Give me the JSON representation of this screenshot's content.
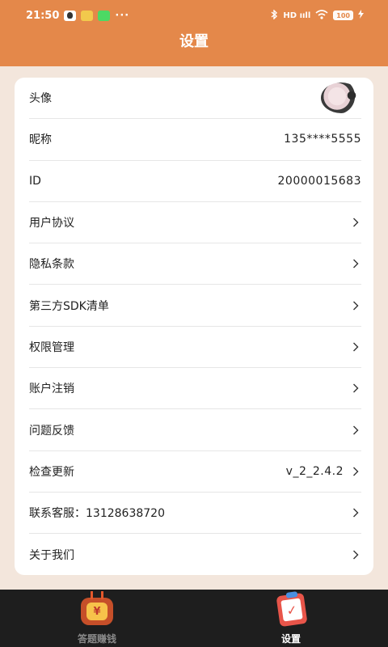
{
  "status_bar": {
    "time": "21:50",
    "dots": "···",
    "signal_text": "HD ııll",
    "battery": "100"
  },
  "header": {
    "title": "设置"
  },
  "settings": [
    {
      "label": "头像",
      "type": "avatar"
    },
    {
      "label": "昵称",
      "value": "135****5555"
    },
    {
      "label": "ID",
      "value": "20000015683"
    },
    {
      "label": "用户协议",
      "chevron": true
    },
    {
      "label": "隐私条款",
      "chevron": true
    },
    {
      "label": "第三方SDK清单",
      "chevron": true
    },
    {
      "label": "权限管理",
      "chevron": true
    },
    {
      "label": "账户注销",
      "chevron": true
    },
    {
      "label": "问题反馈",
      "chevron": true
    },
    {
      "label": "检查更新",
      "value": "v_2_2.4.2",
      "chevron": true
    },
    {
      "label": "联系客服：13128638720",
      "chevron": true
    },
    {
      "label": "关于我们",
      "chevron": true
    }
  ],
  "tabbar": {
    "tabs": [
      {
        "label": "答题赚钱",
        "icon": "tv-coin-icon",
        "active": false,
        "glyph": "¥"
      },
      {
        "label": "设置",
        "icon": "clipboard-check-icon",
        "active": true,
        "glyph": "✓"
      }
    ]
  },
  "colors": {
    "accent": "#e4884a",
    "background": "#f3e6dc",
    "tabbar": "#1e1e1e"
  }
}
